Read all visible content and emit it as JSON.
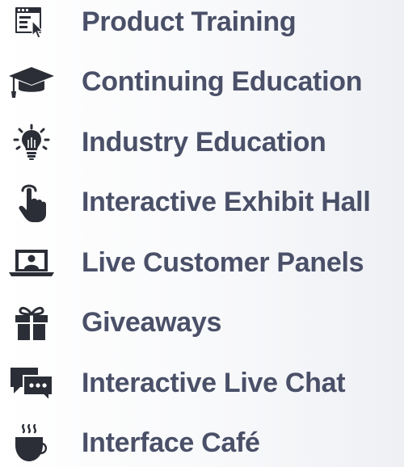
{
  "features": [
    {
      "label": "Product Training",
      "icon": "training-screen-icon"
    },
    {
      "label": "Continuing Education",
      "icon": "graduation-cap-icon"
    },
    {
      "label": "Industry Education",
      "icon": "lightbulb-icon"
    },
    {
      "label": "Interactive Exhibit Hall",
      "icon": "pointing-hand-icon"
    },
    {
      "label": "Live Customer Panels",
      "icon": "laptop-user-icon"
    },
    {
      "label": "Giveaways",
      "icon": "gift-icon"
    },
    {
      "label": "Interactive Live Chat",
      "icon": "chat-bubbles-icon"
    },
    {
      "label": "Interface Café",
      "icon": "coffee-cup-icon"
    }
  ],
  "colors": {
    "text": "#4a5068",
    "icon": "#2b2e36"
  }
}
